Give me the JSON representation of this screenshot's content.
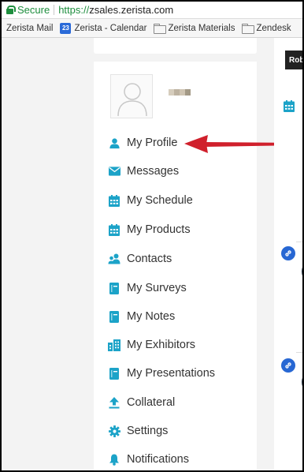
{
  "browser": {
    "secure_label": "Secure",
    "url_scheme": "https://",
    "url_host": "zsales.zerista.com",
    "secure_color": "#1e8e3e"
  },
  "bookmarks": [
    {
      "label": "Zerista Mail",
      "icon": "none"
    },
    {
      "label": "Zerista - Calendar",
      "icon": "calendar-icon",
      "badge": "23"
    },
    {
      "label": "Zerista Materials",
      "icon": "folder-icon"
    },
    {
      "label": "Zendesk",
      "icon": "folder-icon"
    }
  ],
  "profile": {
    "avatar_icon": "user-silhouette-icon",
    "name_redacted": true
  },
  "menu": {
    "accent_color": "#1ca3c8",
    "items": [
      {
        "label": "My Profile",
        "icon": "user-icon"
      },
      {
        "label": "Messages",
        "icon": "envelope-icon"
      },
      {
        "label": "My Schedule",
        "icon": "calendar-icon"
      },
      {
        "label": "My Products",
        "icon": "calendar-icon"
      },
      {
        "label": "Contacts",
        "icon": "users-icon"
      },
      {
        "label": "My Surveys",
        "icon": "book-icon"
      },
      {
        "label": "My Notes",
        "icon": "book-icon"
      },
      {
        "label": "My Exhibitors",
        "icon": "building-icon"
      },
      {
        "label": "My Presentations",
        "icon": "book-icon"
      },
      {
        "label": "Collateral",
        "icon": "upload-icon"
      },
      {
        "label": "Settings",
        "icon": "gear-icon"
      },
      {
        "label": "Notifications",
        "icon": "bell-icon"
      }
    ]
  },
  "annotation": {
    "arrow_color": "#d0202c",
    "points_to": "My Profile"
  },
  "content": {
    "thumbnail_text": "Rob",
    "link_badge_color": "#2767d3"
  }
}
